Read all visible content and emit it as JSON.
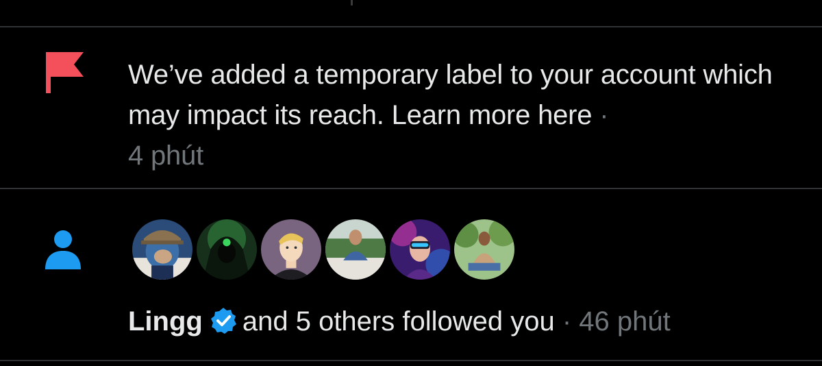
{
  "colors": {
    "background": "#000000",
    "text": "#e7e9ea",
    "muted": "#71767b",
    "divider": "#2f3336",
    "flag": "#f4505c",
    "person": "#1d9bf0",
    "verified": "#1d9bf0"
  },
  "notifications": [
    {
      "icon": "flag-icon",
      "message": "We’ve added a temporary label to your account which may impact its reach. Learn more here",
      "separator": "·",
      "time": "4 phút"
    },
    {
      "icon": "person-icon",
      "user": "Lingg",
      "verified": true,
      "message": "and 5 others followed you",
      "separator": "·",
      "time": "46 phút",
      "avatars": [
        "ape-avatar",
        "hooded-hacker-avatar",
        "cartoon-boy-avatar",
        "man-outdoor-avatar",
        "vr-headset-avatar",
        "man-sitting-avatar"
      ]
    }
  ]
}
